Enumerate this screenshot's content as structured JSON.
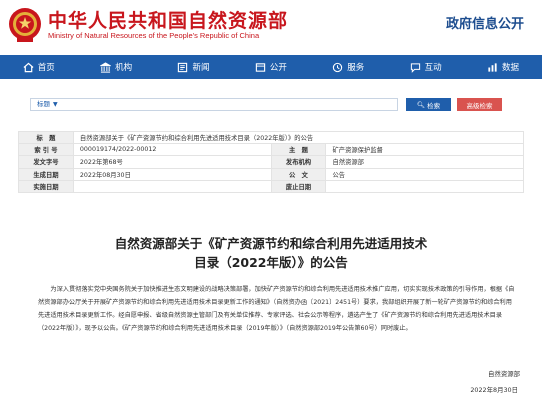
{
  "header": {
    "title": "中华人民共和国自然资源部",
    "subtitle": "Ministry of Natural Resources of the People's Republic of China",
    "right_label": "政府信息公开",
    "brand_color": "#c8161d",
    "emblem_icon": "national-emblem-icon"
  },
  "nav": {
    "background": "#1f5eab",
    "items": [
      {
        "label": "首页",
        "icon": "home-icon"
      },
      {
        "label": "机构",
        "icon": "institution-icon"
      },
      {
        "label": "新闻",
        "icon": "news-icon"
      },
      {
        "label": "公开",
        "icon": "disclosure-icon"
      },
      {
        "label": "服务",
        "icon": "service-icon"
      },
      {
        "label": "互动",
        "icon": "interaction-icon"
      },
      {
        "label": "数据",
        "icon": "data-icon"
      }
    ]
  },
  "search": {
    "selected": "标题",
    "search_label": "检索",
    "advanced_label": "高级检索"
  },
  "meta": {
    "rows": [
      {
        "k1": "标　题",
        "v1": "自然资源部关于《矿产资源节约和综合利用先进适用技术目录（2022年版）》的公告",
        "k2": "",
        "v2": ""
      },
      {
        "k1": "索 引 号",
        "v1": "000019174/2022-00012",
        "k2": "主　题",
        "v2": "矿产资源保护监督"
      },
      {
        "k1": "发文字号",
        "v1": "2022年第68号",
        "k2": "发布机构",
        "v2": "自然资源部"
      },
      {
        "k1": "生成日期",
        "v1": "2022年08月30日",
        "k2": "公　文",
        "v2": "公告"
      },
      {
        "k1": "实施日期",
        "v1": "",
        "k2": "废止日期",
        "v2": ""
      }
    ]
  },
  "article": {
    "title_line1": "自然资源部关于《矿产资源节约和综合利用先进适用技术",
    "title_line2": "目录（2022年版）》的公告",
    "body": "为深入贯彻落实党中央国务院关于加快推进生态文明建设的战略决策部署，加快矿产资源节约和综合利用先进适用技术推广应用，切实实现技术政策的引导作用，根据《自然资源部办公厅关于开展矿产资源节约和综合利用先进适用技术目录更新工作的通知》（自然资办函〔2021〕2451号）要求，我部组织开展了新一轮矿产资源节约和综合利用先进适用技术目录更新工作。经自愿申报、省级自然资源主管部门及有关单位推荐、专家评选、社会公示等程序，遴选产生了《矿产资源节约和综合利用先进适用技术目录（2022年版）》，现予以公告。《矿产资源节约和综合利用先进适用技术目录（2019年版）》（自然资源部2019年公告第60号）同时废止。",
    "signature": "自然资源部",
    "date": "2022年8月30日"
  }
}
